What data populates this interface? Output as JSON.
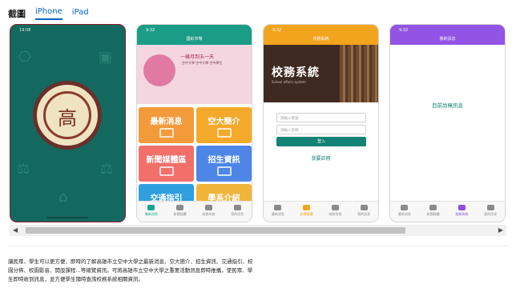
{
  "header": {
    "section_title": "截圖",
    "device_tabs": [
      {
        "label": "iPhone",
        "active": true
      },
      {
        "label": "iPad",
        "active": false
      }
    ]
  },
  "screenshots": {
    "splash": {
      "time": "19:08",
      "emblem_glyph": "高"
    },
    "home": {
      "time": "9:32",
      "title": "國彩市場",
      "banner_title": "一樣月到五一天",
      "banner_sub": "空中大學 空中大學 空中學生",
      "tiles": [
        {
          "label": "最新消息",
          "color": "#f39a3a"
        },
        {
          "label": "空大簡介",
          "color": "#f4a92b"
        },
        {
          "label": "新聞媒體區",
          "color": "#f26f6a"
        },
        {
          "label": "招生資訊",
          "color": "#4e86e8"
        },
        {
          "label": "交通指引",
          "color": "#2f9fe0"
        },
        {
          "label": "學系介紹",
          "color": "#f2b53c"
        }
      ],
      "tabbar": [
        "最新消息",
        "新聞媒體",
        "校務系統",
        "我的訊息"
      ]
    },
    "login": {
      "time": "9:32",
      "title": "校務系統",
      "hero_title": "校務系統",
      "hero_sub": "School affairs system",
      "fields": [
        "請輸入帳號",
        "請輸入密碼"
      ],
      "login_label": "登入",
      "register_label": "我要註冊",
      "tabbar": [
        "最新消息",
        "新聞媒體",
        "校務系統",
        "我的訊息"
      ]
    },
    "messages": {
      "time": "9:32",
      "title": "我的訊息",
      "empty_text": "目前尚無訊息",
      "tabbar": [
        "最新消息",
        "新聞媒體",
        "校務系統",
        "我的訊息"
      ]
    }
  },
  "description": {
    "line1": "讓民眾、學生可以更方便、即時的了解高雄市立空中大學之最新消息、空大簡介、招生資訊、交通指引、校",
    "line2": "園分佈、校園影音、開設課程...等總覽資訊。可將高雄市立空中大學之重要活動訊息即時推播，使民眾、學",
    "line3": "生即時收到訊息，並方便學生隨時查詢校務系統相關資訊。"
  },
  "scroll": {
    "left_arrow": "◀",
    "right_arrow": "▶"
  }
}
